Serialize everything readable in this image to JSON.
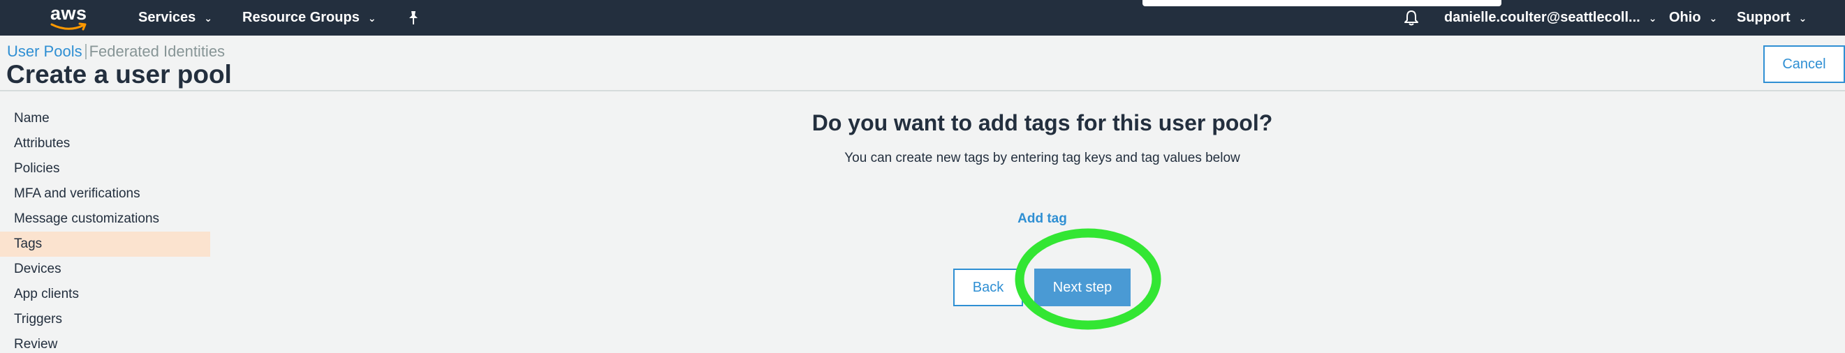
{
  "topnav": {
    "logo_text": "aws",
    "services_label": "Services",
    "resource_groups_label": "Resource Groups",
    "user_label": "danielle.coulter@seattlecoll...",
    "region_label": "Ohio",
    "support_label": "Support"
  },
  "breadcrumb": {
    "user_pools": "User Pools",
    "federated": "Federated Identities"
  },
  "page": {
    "title": "Create a user pool",
    "cancel_label": "Cancel"
  },
  "sidebar": {
    "items": [
      {
        "label": "Name"
      },
      {
        "label": "Attributes"
      },
      {
        "label": "Policies"
      },
      {
        "label": "MFA and verifications"
      },
      {
        "label": "Message customizations"
      },
      {
        "label": "Tags",
        "selected": true
      },
      {
        "label": "Devices"
      },
      {
        "label": "App clients"
      },
      {
        "label": "Triggers"
      },
      {
        "label": "Review"
      }
    ]
  },
  "main": {
    "heading": "Do you want to add tags for this user pool?",
    "subheading": "You can create new tags by entering tag keys and tag values below",
    "add_tag_label": "Add tag",
    "back_label": "Back",
    "next_label": "Next step"
  },
  "colors": {
    "nav_bg": "#232f3e",
    "accent_blue": "#2f8fd3",
    "selected_bg": "#fbe3cf",
    "highlight_green": "#33e633"
  }
}
